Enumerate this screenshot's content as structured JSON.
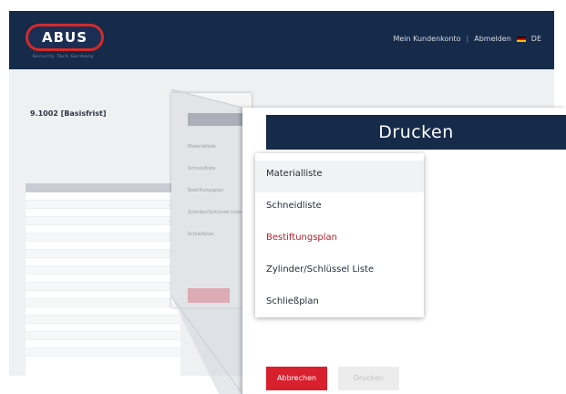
{
  "colors": {
    "header_bg": "#162a4a",
    "accent_red": "#d8202e",
    "link_red": "#b21f2d"
  },
  "app": {
    "logo_text": "ABUS",
    "tagline": "Security Tech Germany",
    "nav": {
      "account": "Mein Kundenkonto",
      "logout": "Abmelden",
      "language": "DE"
    },
    "project_title": "9.1002 [Basisfrist]"
  },
  "dialog": {
    "title": "Drucken",
    "menu_items": [
      "Materialliste",
      "Schneidliste",
      "Bestiftungsplan",
      "Zylinder/Schlüssel Liste",
      "Schließplan"
    ],
    "cancel_label": "Abbrechen",
    "print_label": "Drucken"
  }
}
